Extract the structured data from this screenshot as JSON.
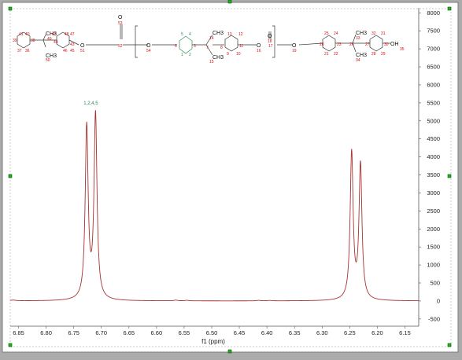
{
  "chart_data": {
    "type": "line",
    "title": "",
    "xlabel": "f1 (ppm)",
    "ylabel": "",
    "x_reversed": true,
    "xlim": [
      6.865,
      6.125
    ],
    "ylim": [
      -700,
      8050
    ],
    "grid": false,
    "line_color": "#a83232",
    "x_ticks": [
      6.85,
      6.8,
      6.75,
      6.7,
      6.65,
      6.6,
      6.55,
      6.5,
      6.45,
      6.4,
      6.35,
      6.3,
      6.25,
      6.2,
      6.15
    ],
    "x_tick_labels": [
      "6.85",
      "6.80",
      "6.75",
      "6.70",
      "6.65",
      "6.60",
      "6.55",
      "6.50",
      "6.45",
      "6.40",
      "6.35",
      "6.30",
      "6.25",
      "6.20",
      "6.15"
    ],
    "y_ticks": [
      8000,
      7500,
      7000,
      6500,
      6000,
      5500,
      5000,
      4500,
      4000,
      3500,
      3000,
      2500,
      2000,
      1500,
      1000,
      500,
      0,
      -500
    ],
    "y_tick_labels": [
      "8000",
      "7500",
      "7000",
      "6500",
      "6000",
      "5500",
      "5000",
      "4500",
      "4000",
      "3500",
      "3000",
      "2500",
      "2000",
      "1500",
      "1000",
      "500",
      "0",
      "-500"
    ],
    "peaks": [
      {
        "ppm": 6.7265,
        "height": 4780,
        "width": 0.0032
      },
      {
        "ppm": 6.7105,
        "height": 5120,
        "width": 0.0032
      },
      {
        "ppm": 6.2465,
        "height": 4080,
        "width": 0.0032
      },
      {
        "ppm": 6.2305,
        "height": 3750,
        "width": 0.0032
      },
      {
        "ppm": 6.565,
        "height": 18,
        "width": 0.004
      },
      {
        "ppm": 6.545,
        "height": 14,
        "width": 0.004
      },
      {
        "ppm": 6.415,
        "height": 14,
        "width": 0.004
      },
      {
        "ppm": 6.395,
        "height": 12,
        "width": 0.004
      },
      {
        "ppm": 6.86,
        "height": 20,
        "width": 0.006
      }
    ],
    "annotations": [
      {
        "text": "1,2,4,5",
        "ppm": 6.719,
        "y": 5450
      }
    ]
  },
  "structure": {
    "labels_text": [
      "CH3",
      "CH3",
      "O",
      "O",
      "O",
      "O",
      "O",
      "O",
      "CH3",
      "CH3",
      "CH3",
      "CH3",
      "OH"
    ],
    "atom_numbers": [
      "41",
      "40",
      "39",
      "38",
      "37",
      "36",
      "49",
      "48",
      "50",
      "47",
      "46",
      "45",
      "44",
      "43",
      "42",
      "51",
      "52",
      "53",
      "54",
      "1",
      "2",
      "3",
      "4",
      "5",
      "6",
      "7",
      "8",
      "14",
      "15",
      "9",
      "10",
      "11",
      "12",
      "13",
      "16",
      "17",
      "18",
      "19",
      "20",
      "21",
      "22",
      "23",
      "24",
      "25",
      "26",
      "27",
      "28",
      "29",
      "30",
      "31",
      "32",
      "33",
      "34",
      "35"
    ]
  }
}
